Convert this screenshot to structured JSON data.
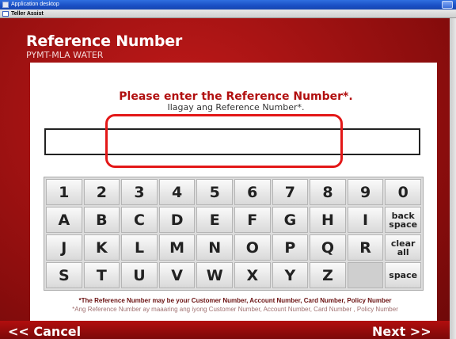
{
  "window": {
    "title": "Application desktop",
    "subtitle": "Teller Assist"
  },
  "header": {
    "title": "Reference Number",
    "subtitle": "PYMT-MLA WATER"
  },
  "prompt": {
    "main": "Please enter the Reference Number",
    "main_suffix": "*.",
    "sub": "Ilagay ang Reference Number*."
  },
  "input": {
    "value": "",
    "placeholder": ""
  },
  "keypad": {
    "rows": [
      [
        "1",
        "2",
        "3",
        "4",
        "5",
        "6",
        "7",
        "8",
        "9",
        "0"
      ],
      [
        "A",
        "B",
        "C",
        "D",
        "E",
        "F",
        "G",
        "H",
        "I",
        "back space"
      ],
      [
        "J",
        "K",
        "L",
        "M",
        "N",
        "O",
        "P",
        "Q",
        "R",
        "clear all"
      ],
      [
        "S",
        "T",
        "U",
        "V",
        "W",
        "X",
        "Y",
        "Z",
        "",
        "space"
      ]
    ]
  },
  "notes": {
    "english": "*The Reference Number may be your Customer Number, Account Number, Card Number, Policy Number",
    "filipino": "*Ang Reference Number ay maaaring ang iyong Customer Number, Account Number, Card Number , Policy Number"
  },
  "buttons": {
    "cancel": "<< Cancel",
    "next": "Next  >>"
  },
  "colors": {
    "brand_red": "#b10f0f",
    "highlight": "#e31717"
  }
}
